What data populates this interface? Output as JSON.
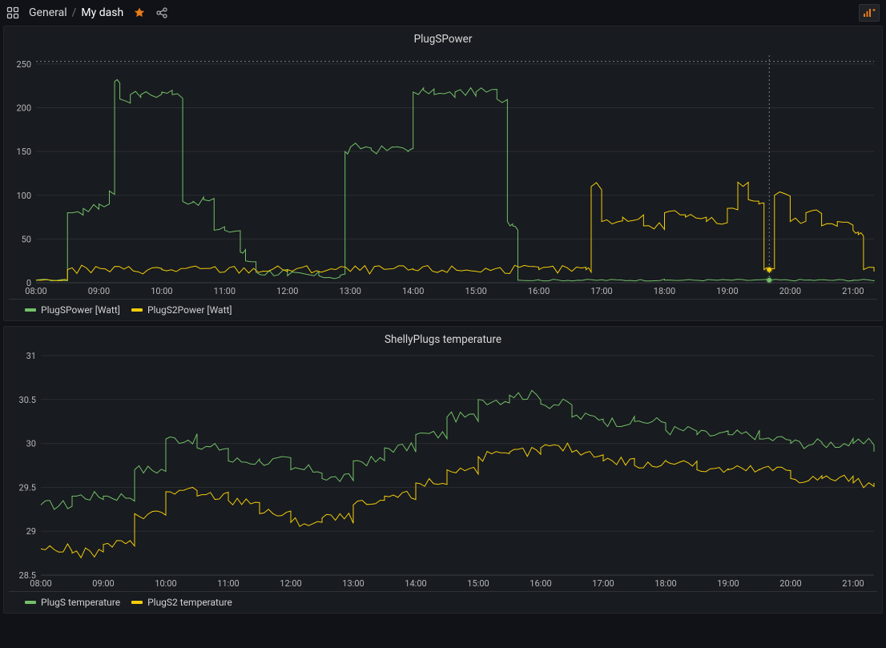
{
  "header": {
    "folder": "General",
    "separator": "/",
    "dash": "My dash"
  },
  "colors": {
    "green": "#73bf69",
    "yellow": "#f2cc0c"
  },
  "panels": [
    {
      "id": "power",
      "title": "PlugSPower",
      "legend": [
        "PlugSPower [Watt]",
        "PlugS2Power [Watt]"
      ]
    },
    {
      "id": "temp",
      "title": "ShellyPlugs temperature",
      "legend": [
        "PlugS temperature",
        "PlugS2 temperature"
      ]
    }
  ],
  "chart_data": [
    {
      "id": "power",
      "type": "line",
      "title": "PlugSPower",
      "xlabel": "",
      "ylabel": "",
      "ylim": [
        0,
        260
      ],
      "x_ticks": [
        "08:00",
        "09:00",
        "10:00",
        "11:00",
        "12:00",
        "13:00",
        "14:00",
        "15:00",
        "16:00",
        "17:00",
        "18:00",
        "19:00",
        "20:00",
        "21:00"
      ],
      "y_ticks": [
        0,
        50,
        100,
        150,
        200,
        250
      ],
      "cursor_x": "19:40",
      "threshold_y": 253,
      "series": [
        {
          "name": "PlugSPower [Watt]",
          "color": "#73bf69",
          "x": [
            "08:00",
            "08:25",
            "08:30",
            "08:45",
            "09:00",
            "09:10",
            "09:15",
            "09:20",
            "09:30",
            "09:40",
            "10:00",
            "10:10",
            "10:20",
            "10:30",
            "10:40",
            "10:50",
            "11:00",
            "11:15",
            "11:20",
            "11:30",
            "12:00",
            "12:30",
            "12:50",
            "12:55",
            "13:00",
            "13:20",
            "13:40",
            "13:55",
            "14:00",
            "14:10",
            "14:20",
            "14:40",
            "15:00",
            "15:20",
            "15:30",
            "15:35",
            "15:40",
            "16:00",
            "18:00",
            "21:00",
            "21:20"
          ],
          "values": [
            3,
            3,
            80,
            85,
            90,
            105,
            230,
            210,
            215,
            215,
            218,
            215,
            93,
            93,
            95,
            60,
            60,
            35,
            25,
            12,
            8,
            8,
            8,
            150,
            155,
            152,
            155,
            150,
            218,
            220,
            215,
            218,
            218,
            210,
            70,
            65,
            3,
            3,
            3,
            3,
            3
          ]
        },
        {
          "name": "PlugS2Power [Watt]",
          "color": "#f2cc0c",
          "x": [
            "08:00",
            "08:25",
            "08:30",
            "10:00",
            "12:00",
            "14:00",
            "16:00",
            "16:45",
            "16:50",
            "17:00",
            "17:20",
            "17:40",
            "18:00",
            "18:20",
            "18:40",
            "19:00",
            "19:10",
            "19:20",
            "19:30",
            "19:35",
            "19:40",
            "19:45",
            "20:00",
            "20:15",
            "20:30",
            "20:45",
            "21:00",
            "21:05",
            "21:10",
            "21:20"
          ],
          "values": [
            3,
            3,
            15,
            15,
            15,
            15,
            15,
            15,
            110,
            70,
            75,
            65,
            80,
            75,
            70,
            85,
            115,
            95,
            90,
            15,
            15,
            100,
            70,
            80,
            65,
            70,
            60,
            55,
            15,
            15
          ]
        }
      ]
    },
    {
      "id": "temp",
      "type": "line",
      "title": "ShellyPlugs temperature",
      "xlabel": "",
      "ylabel": "",
      "ylim": [
        28.5,
        31.0
      ],
      "x_ticks": [
        "08:00",
        "09:00",
        "10:00",
        "11:00",
        "12:00",
        "13:00",
        "14:00",
        "15:00",
        "16:00",
        "17:00",
        "18:00",
        "19:00",
        "20:00",
        "21:00"
      ],
      "y_ticks": [
        28.5,
        29.0,
        29.5,
        30.0,
        30.5,
        31.0
      ],
      "series": [
        {
          "name": "PlugS temperature",
          "color": "#73bf69",
          "x": [
            "08:00",
            "08:30",
            "09:00",
            "09:30",
            "10:00",
            "10:30",
            "11:00",
            "11:30",
            "12:00",
            "12:30",
            "13:00",
            "13:30",
            "14:00",
            "14:30",
            "15:00",
            "15:30",
            "16:00",
            "16:30",
            "17:00",
            "17:30",
            "18:00",
            "18:30",
            "19:00",
            "19:30",
            "20:00",
            "20:30",
            "21:00",
            "21:20"
          ],
          "values": [
            29.3,
            29.4,
            29.4,
            29.7,
            30.05,
            29.95,
            29.8,
            29.8,
            29.7,
            29.6,
            29.8,
            29.95,
            30.1,
            30.3,
            30.5,
            30.55,
            30.45,
            30.3,
            30.25,
            30.25,
            30.15,
            30.1,
            30.1,
            30.05,
            30.0,
            30.0,
            30.0,
            29.95
          ]
        },
        {
          "name": "PlugS2 temperature",
          "color": "#f2cc0c",
          "x": [
            "08:00",
            "08:30",
            "09:00",
            "09:30",
            "10:00",
            "10:30",
            "11:00",
            "11:30",
            "12:00",
            "12:30",
            "13:00",
            "13:30",
            "14:00",
            "14:30",
            "15:00",
            "15:30",
            "16:00",
            "16:30",
            "17:00",
            "17:30",
            "18:00",
            "18:30",
            "19:00",
            "19:30",
            "20:00",
            "20:30",
            "21:00",
            "21:20"
          ],
          "values": [
            28.8,
            28.75,
            28.85,
            29.2,
            29.45,
            29.4,
            29.35,
            29.2,
            29.1,
            29.15,
            29.3,
            29.4,
            29.55,
            29.7,
            29.85,
            29.9,
            29.95,
            29.9,
            29.8,
            29.75,
            29.8,
            29.7,
            29.7,
            29.7,
            29.6,
            29.6,
            29.55,
            29.55
          ]
        }
      ]
    }
  ]
}
